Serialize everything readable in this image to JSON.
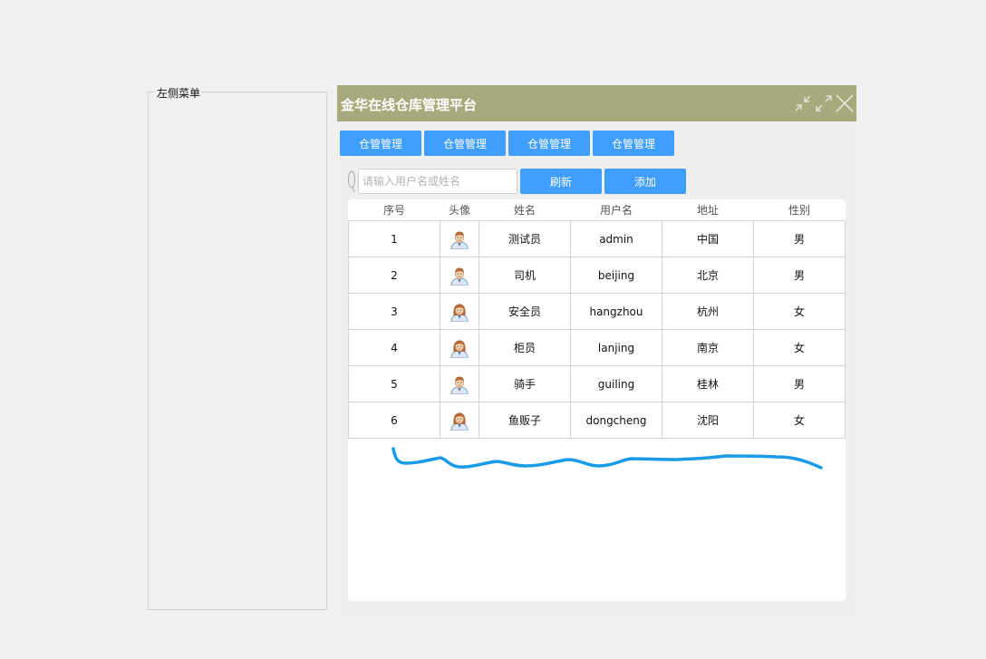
{
  "left_menu": {
    "legend": "左侧菜单"
  },
  "window": {
    "title": "金华在线仓库管理平台",
    "title_bar_color": "#a9a97e",
    "controls": [
      "shrink-icon",
      "expand-icon",
      "close-icon"
    ]
  },
  "tabs": [
    {
      "label": "仓管管理"
    },
    {
      "label": "仓管管理"
    },
    {
      "label": "仓管管理"
    },
    {
      "label": "仓管管理"
    }
  ],
  "toolbar": {
    "search_placeholder": "请输入用户名或姓名",
    "search_value": "",
    "refresh_label": "刷新",
    "add_label": "添加",
    "accent_color": "#409eff"
  },
  "table": {
    "headers": [
      "序号",
      "头像",
      "姓名",
      "用户名",
      "地址",
      "性别"
    ],
    "rows": [
      {
        "id": "1",
        "avatar": "male-avatar-icon",
        "name": "测试员",
        "username": "admin",
        "address": "中国",
        "gender": "男"
      },
      {
        "id": "2",
        "avatar": "male-avatar-icon",
        "name": "司机",
        "username": "beijing",
        "address": "北京",
        "gender": "男"
      },
      {
        "id": "3",
        "avatar": "female-avatar-icon",
        "name": "安全员",
        "username": "hangzhou",
        "address": "杭州",
        "gender": "女"
      },
      {
        "id": "4",
        "avatar": "female-avatar-icon",
        "name": "柜员",
        "username": "lanjing",
        "address": "南京",
        "gender": "女"
      },
      {
        "id": "5",
        "avatar": "male-avatar-icon",
        "name": "骑手",
        "username": "guiling",
        "address": "桂林",
        "gender": "男"
      },
      {
        "id": "6",
        "avatar": "female-avatar-icon",
        "name": "鱼贩子",
        "username": "dongcheng",
        "address": "沈阳",
        "gender": "女"
      }
    ]
  },
  "annotation": {
    "stroke_color": "#1a9bea"
  }
}
